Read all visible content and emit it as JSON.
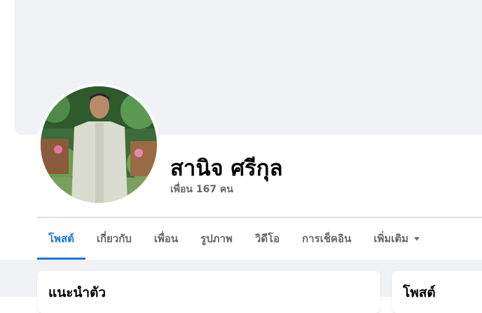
{
  "profile": {
    "name": "สานิจ ศรีกุล",
    "friends": "เพื่อน 167 คน"
  },
  "tabs": [
    {
      "label": "โพสต์"
    },
    {
      "label": "เกี่ยวกับ"
    },
    {
      "label": "เพื่อน"
    },
    {
      "label": "รูปภาพ"
    },
    {
      "label": "วิดีโอ"
    },
    {
      "label": "การเช็คอิน"
    },
    {
      "label": "เพิ่มเติม"
    }
  ],
  "active_tab": "โพสต์",
  "cards": {
    "intro_title": "แนะนำตัว",
    "posts_title": "โพสต์"
  },
  "colors": {
    "accent": "#1b74e4",
    "page_background": "#f0f2f5",
    "secondary_text": "#65676b"
  }
}
